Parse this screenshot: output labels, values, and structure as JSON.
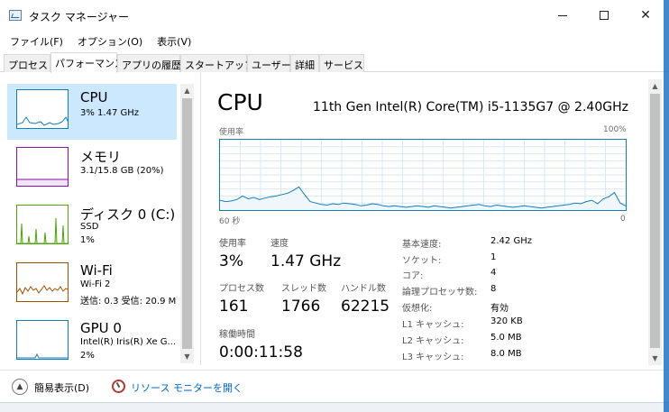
{
  "window": {
    "title": "タスク マネージャー"
  },
  "menu": [
    "ファイル(F)",
    "オプション(O)",
    "表示(V)"
  ],
  "tabs": [
    "プロセス",
    "パフォーマンス",
    "アプリの履歴",
    "スタートアップ",
    "ユーザー",
    "詳細",
    "サービス"
  ],
  "active_tab": "パフォーマンス",
  "resources": [
    {
      "name": "CPU",
      "line1": "3% 1.47 GHz",
      "line2": "",
      "color": "#117dbb"
    },
    {
      "name": "メモリ",
      "line1": "3.1/15.8 GB (20%)",
      "line2": "",
      "color": "#8b12ae"
    },
    {
      "name": "ディスク 0 (C:)",
      "line1": "SSD",
      "line2": "1%",
      "color": "#4da60c"
    },
    {
      "name": "Wi-Fi",
      "line1": "Wi-Fi 2",
      "line2": "送信: 0.3 受信: 20.9 M",
      "color": "#a74f01"
    },
    {
      "name": "GPU 0",
      "line1": "Intel(R) Iris(R) Xe G...",
      "line2": "2%",
      "color": "#117dbb"
    }
  ],
  "detail": {
    "title": "CPU",
    "model": "11th Gen Intel(R) Core(TM) i5-1135G7 @ 2.40GHz",
    "usage_label": "使用率",
    "max_label": "100%",
    "time_label": "60 秒",
    "zero_label": "0",
    "utilization_label": "使用率",
    "utilization": "3%",
    "speed_label": "速度",
    "speed": "1.47 GHz",
    "processes_label": "プロセス数",
    "processes": "161",
    "threads_label": "スレッド数",
    "threads": "1766",
    "handles_label": "ハンドル数",
    "handles": "62215",
    "uptime_label": "稼働時間",
    "uptime": "0:00:11:58",
    "info": [
      {
        "label": "基本速度:",
        "value": "2.42 GHz"
      },
      {
        "label": "ソケット:",
        "value": "1"
      },
      {
        "label": "コア:",
        "value": "4"
      },
      {
        "label": "論理プロセッサ数:",
        "value": "8"
      },
      {
        "label": "仮想化:",
        "value": "有効"
      },
      {
        "label": "L1 キャッシュ:",
        "value": "320 KB"
      },
      {
        "label": "L2 キャッシュ:",
        "value": "5.0 MB"
      },
      {
        "label": "L3 キャッシュ:",
        "value": "8.0 MB"
      }
    ]
  },
  "cpu_graph": [
    14,
    12,
    13,
    15,
    20,
    16,
    18,
    15,
    17,
    19,
    20,
    22,
    24,
    28,
    33,
    22,
    12,
    10,
    8,
    7,
    9,
    8,
    10,
    9,
    8,
    6,
    7,
    9,
    8,
    6,
    5,
    6,
    5,
    4,
    5,
    6,
    5,
    4,
    6,
    5,
    4,
    3,
    4,
    5,
    6,
    7,
    8,
    6,
    5,
    7,
    6,
    5,
    4,
    5,
    6,
    5,
    4,
    3,
    4,
    5,
    6,
    7,
    8,
    10,
    9,
    12,
    14,
    9,
    16,
    19,
    25,
    10,
    6
  ],
  "footer": {
    "fewer_details": "簡易表示(D)",
    "open_monitor": "リソース モニターを開く"
  }
}
